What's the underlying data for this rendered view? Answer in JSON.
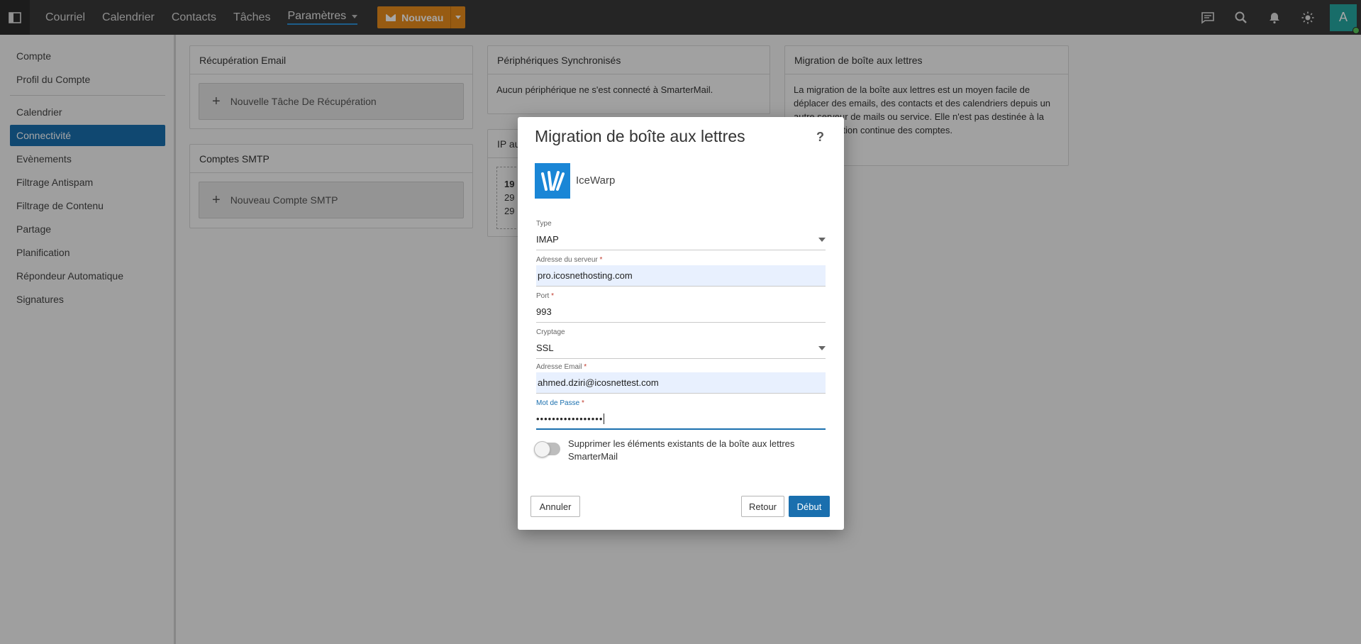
{
  "topbar": {
    "nav": [
      "Courriel",
      "Calendrier",
      "Contacts",
      "Tâches"
    ],
    "settings_label": "Paramètres",
    "new_label": "Nouveau",
    "avatar_letter": "A",
    "accent_color": "#1a6fae",
    "new_button_color": "#e88d1d"
  },
  "sidebar": {
    "items": [
      "Compte",
      "Profil du Compte",
      "Calendrier",
      "Connectivité",
      "Evènements",
      "Filtrage Antispam",
      "Filtrage de Contenu",
      "Partage",
      "Planification",
      "Répondeur Automatique",
      "Signatures"
    ],
    "active": "Connectivité"
  },
  "cards": {
    "email_retrieval": {
      "title": "Récupération Email",
      "button": "Nouvelle Tâche De Récupération"
    },
    "smtp_accounts": {
      "title": "Comptes SMTP",
      "button": "Nouveau Compte SMTP"
    },
    "synced_devices": {
      "title": "Périphériques Synchronisés",
      "text": "Aucun périphérique ne s'est connecté à SmarterMail."
    },
    "ip": {
      "title": "IP au",
      "line1": "19",
      "line2": "29",
      "line3": "29"
    },
    "mailbox_migration": {
      "title": "Migration de boîte aux lettres",
      "text": "La migration de la boîte aux lettres est un moyen facile de déplacer des emails, des contacts et des calendriers depuis un autre serveur de mails ou service. Elle n'est pas destinée à la synchronisation continue des comptes."
    }
  },
  "modal": {
    "title": "Migration de boîte aux lettres",
    "help": "?",
    "provider": "IceWarp",
    "fields": {
      "type": {
        "label": "Type",
        "value": "IMAP"
      },
      "server": {
        "label": "Adresse du serveur",
        "value": "pro.icosnethosting.com"
      },
      "port": {
        "label": "Port",
        "value": "993"
      },
      "encryption": {
        "label": "Cryptage",
        "value": "SSL"
      },
      "email": {
        "label": "Adresse Email",
        "value": "ahmed.dziri@icosnettest.com"
      },
      "password": {
        "label": "Mot de Passe",
        "value": "•••••••••••••••••"
      }
    },
    "required_mark": "*",
    "toggle_label": "Supprimer les éléments existants de la boîte aux lettres SmarterMail",
    "toggle_on": false,
    "buttons": {
      "cancel": "Annuler",
      "back": "Retour",
      "start": "Début"
    }
  }
}
